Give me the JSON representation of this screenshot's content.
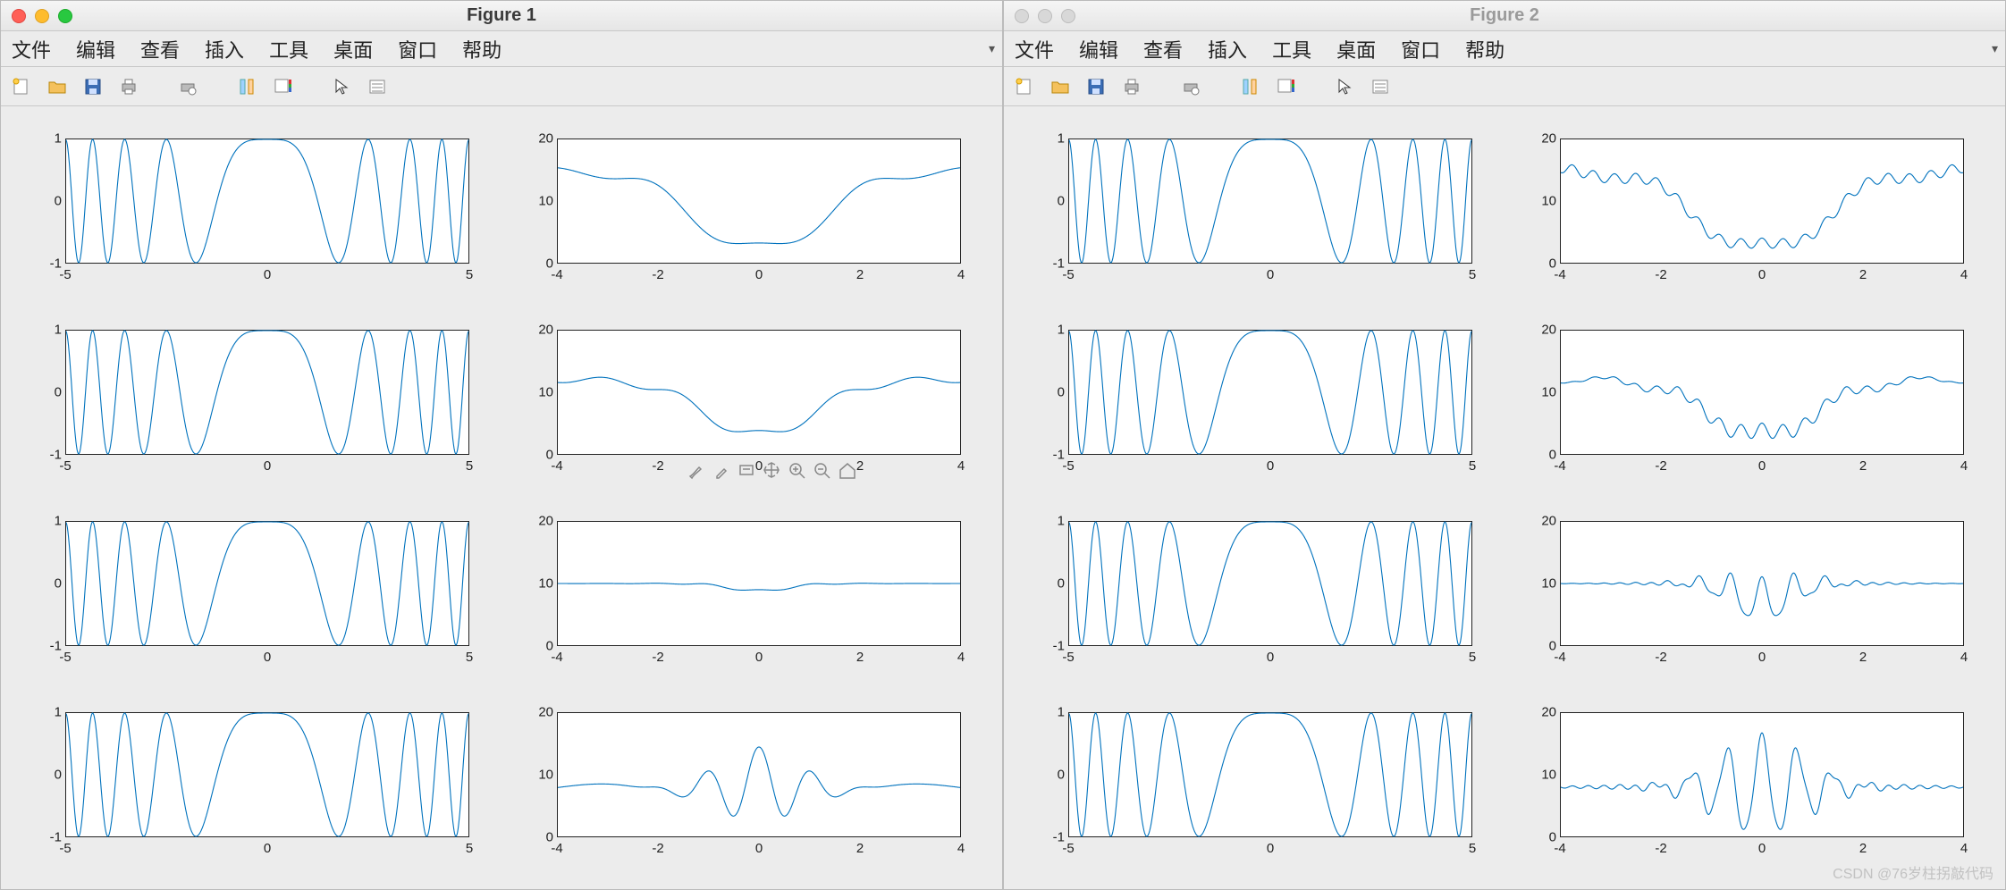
{
  "windows": [
    {
      "title": "Figure 1",
      "active": true
    },
    {
      "title": "Figure 2",
      "active": false
    }
  ],
  "menu": [
    "文件",
    "编辑",
    "查看",
    "插入",
    "工具",
    "桌面",
    "窗口",
    "帮助"
  ],
  "toolbar_icons": [
    "new-figure",
    "open",
    "save",
    "print",
    "print-preview",
    "link-axes",
    "colorbar",
    "cursor",
    "legend"
  ],
  "hover_tools": [
    "brush",
    "marker",
    "annotate",
    "pan",
    "zoom-in",
    "zoom-out",
    "home"
  ],
  "watermark": "CSDN @76岁柱拐敲代码",
  "chart_data": [
    {
      "figure": 1,
      "layout": "4x2",
      "subplots": [
        {
          "row": 1,
          "col": 1,
          "type": "line",
          "xlim": [
            -5,
            5
          ],
          "ylim": [
            -1,
            1
          ],
          "xticks": [
            -5,
            0,
            5
          ],
          "yticks": [
            -1,
            0,
            1
          ],
          "ylabel": "",
          "xlabel": "",
          "curve": "chirp_a",
          "note": "cos(x^2) style chirp"
        },
        {
          "row": 1,
          "col": 2,
          "type": "line",
          "xlim": [
            -4,
            4
          ],
          "ylim": [
            0,
            20
          ],
          "xticks": [
            -4,
            -2,
            0,
            2,
            4
          ],
          "yticks": [
            0,
            10,
            20
          ],
          "curve": "bowl_narrow",
          "note": "smooth U envelope, min≈2 at 0, peaks≈15"
        },
        {
          "row": 2,
          "col": 1,
          "type": "line",
          "xlim": [
            -5,
            5
          ],
          "ylim": [
            -1,
            1
          ],
          "xticks": [
            -5,
            0,
            5
          ],
          "yticks": [
            -1,
            0,
            1
          ],
          "curve": "chirp_a"
        },
        {
          "row": 2,
          "col": 2,
          "type": "line",
          "xlim": [
            -4,
            4
          ],
          "ylim": [
            0,
            20
          ],
          "xticks": [
            -4,
            -2,
            0,
            2,
            4
          ],
          "yticks": [
            0,
            10,
            20
          ],
          "curve": "bowl_wide",
          "note": "smooth U envelope, min≈3 at 0, flat ≈12 at edges"
        },
        {
          "row": 3,
          "col": 1,
          "type": "line",
          "xlim": [
            -5,
            5
          ],
          "ylim": [
            -1,
            1
          ],
          "xticks": [
            -5,
            0,
            5
          ],
          "yticks": [
            -1,
            0,
            1
          ],
          "curve": "chirp_a"
        },
        {
          "row": 3,
          "col": 2,
          "type": "line",
          "xlim": [
            -4,
            4
          ],
          "ylim": [
            0,
            20
          ],
          "xticks": [
            -4,
            -2,
            0,
            2,
            4
          ],
          "yticks": [
            0,
            10,
            20
          ],
          "curve": "flat10_smalldip",
          "note": "≈10 flat, small dip near 0"
        },
        {
          "row": 4,
          "col": 1,
          "type": "line",
          "xlim": [
            -5,
            5
          ],
          "ylim": [
            -1,
            1
          ],
          "xticks": [
            -5,
            0,
            5
          ],
          "yticks": [
            -1,
            0,
            1
          ],
          "curve": "chirp_a"
        },
        {
          "row": 4,
          "col": 2,
          "type": "line",
          "xlim": [
            -4,
            4
          ],
          "ylim": [
            0,
            20
          ],
          "xticks": [
            -4,
            -2,
            0,
            2,
            4
          ],
          "yticks": [
            0,
            10,
            20
          ],
          "curve": "packet_smooth",
          "note": "centered wave packet around y=8, swings ≈3..15 near 0"
        }
      ]
    },
    {
      "figure": 2,
      "layout": "4x2",
      "subplots": [
        {
          "row": 1,
          "col": 1,
          "type": "line",
          "xlim": [
            -5,
            5
          ],
          "ylim": [
            -1,
            1
          ],
          "xticks": [
            -5,
            0,
            5
          ],
          "yticks": [
            -1,
            0,
            1
          ],
          "curve": "chirp_a"
        },
        {
          "row": 1,
          "col": 2,
          "type": "line",
          "xlim": [
            -4,
            4
          ],
          "ylim": [
            0,
            20
          ],
          "xticks": [
            -4,
            -2,
            0,
            2,
            4
          ],
          "yticks": [
            0,
            10,
            20
          ],
          "curve": "bowl_narrow_noisy",
          "note": "U + high-freq ripple"
        },
        {
          "row": 2,
          "col": 1,
          "type": "line",
          "xlim": [
            -5,
            5
          ],
          "ylim": [
            -1,
            1
          ],
          "xticks": [
            -5,
            0,
            5
          ],
          "yticks": [
            -1,
            0,
            1
          ],
          "curve": "chirp_a"
        },
        {
          "row": 2,
          "col": 2,
          "type": "line",
          "xlim": [
            -4,
            4
          ],
          "ylim": [
            0,
            20
          ],
          "xticks": [
            -4,
            -2,
            0,
            2,
            4
          ],
          "yticks": [
            0,
            10,
            20
          ],
          "curve": "bowl_wide_noisy"
        },
        {
          "row": 3,
          "col": 1,
          "type": "line",
          "xlim": [
            -5,
            5
          ],
          "ylim": [
            -1,
            1
          ],
          "xticks": [
            -5,
            0,
            5
          ],
          "yticks": [
            -1,
            0,
            1
          ],
          "curve": "chirp_a"
        },
        {
          "row": 3,
          "col": 2,
          "type": "line",
          "xlim": [
            -4,
            4
          ],
          "ylim": [
            0,
            20
          ],
          "xticks": [
            -4,
            -2,
            0,
            2,
            4
          ],
          "yticks": [
            0,
            10,
            20
          ],
          "curve": "flat10_noisy",
          "note": "≈10 baseline with strong burst near 0"
        },
        {
          "row": 4,
          "col": 1,
          "type": "line",
          "xlim": [
            -5,
            5
          ],
          "ylim": [
            -1,
            1
          ],
          "xticks": [
            -5,
            0,
            5
          ],
          "yticks": [
            -1,
            0,
            1
          ],
          "curve": "chirp_a"
        },
        {
          "row": 4,
          "col": 2,
          "type": "line",
          "xlim": [
            -4,
            4
          ],
          "ylim": [
            0,
            20
          ],
          "xticks": [
            -4,
            -2,
            0,
            2,
            4
          ],
          "yticks": [
            0,
            10,
            20
          ],
          "curve": "packet_noisy",
          "note": "wave packet around y=8, swings ≈3..17"
        }
      ]
    }
  ]
}
